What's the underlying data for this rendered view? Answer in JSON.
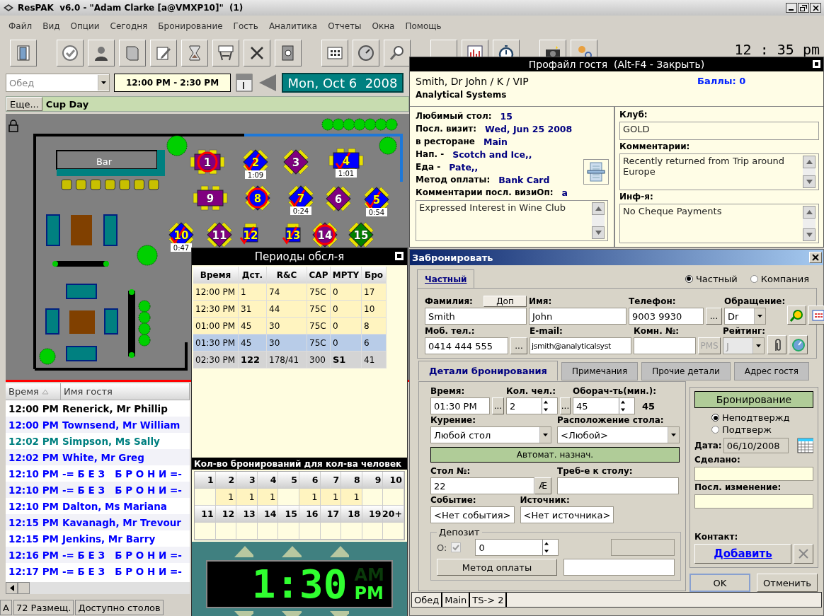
{
  "window": {
    "title": "ResPAK  v6.0 - \"Adam Clarke [a@VMXP10]\"  (1)"
  },
  "menu": [
    "Файл",
    "Вид",
    "Опции",
    "Сегодня",
    "Бронирование",
    "Гость",
    "Аналитика",
    "Отчеты",
    "Окна",
    "Помощь"
  ],
  "toolbar": {
    "clock": "12 : 35 pm"
  },
  "controls": {
    "shift": "Обед",
    "time_range": "12:00 PM - 2:30 PM",
    "date": "Mon, Oct 6  2008"
  },
  "event_bar": {
    "button": "Еще...",
    "event": "Cup Day"
  },
  "floor_plan": {
    "bar_label": "Bar",
    "tables": [
      {
        "number": "1",
        "kind": "rect",
        "color": "#800080",
        "checked": false,
        "circled": true
      },
      {
        "number": "2",
        "kind": "diamond",
        "color": "#0000ff",
        "checked": true,
        "circled": false,
        "timer": "1:09"
      },
      {
        "number": "3",
        "kind": "diamond",
        "color": "#800080",
        "checked": false,
        "circled": false
      },
      {
        "number": "4",
        "kind": "rect",
        "color": "#0000ff",
        "checked": true,
        "circled": false,
        "timer": "1:01"
      },
      {
        "number": "9",
        "kind": "rect",
        "color": "#800080",
        "checked": false,
        "circled": false
      },
      {
        "number": "8",
        "kind": "diamond",
        "color": "#0000ff",
        "checked": false,
        "circled": true
      },
      {
        "number": "7",
        "kind": "diamond",
        "color": "#0000ff",
        "checked": true,
        "circled": false,
        "timer": "0:24"
      },
      {
        "number": "6",
        "kind": "diamond",
        "color": "#800080",
        "checked": false,
        "circled": false
      },
      {
        "number": "5",
        "kind": "diamond",
        "color": "#0000ff",
        "checked": true,
        "circled": false,
        "timer": "0:54"
      },
      {
        "number": "10",
        "kind": "diamond",
        "color": "#0000ff",
        "checked": true,
        "circled": false,
        "timer": "0:47"
      },
      {
        "number": "11",
        "kind": "diamond",
        "color": "#800080",
        "checked": false,
        "circled": false
      },
      {
        "number": "12",
        "kind": "square",
        "color": "#0000ff",
        "checked": true,
        "circled": false
      },
      {
        "number": "13",
        "kind": "square",
        "color": "#0000ff",
        "checked": true,
        "circled": false
      },
      {
        "number": "14",
        "kind": "diamond",
        "color": "#800080",
        "checked": false,
        "circled": true
      },
      {
        "number": "15",
        "kind": "diamond",
        "color": "#008000",
        "checked": false,
        "circled": false
      }
    ]
  },
  "guest_list": {
    "columns": [
      {
        "label": "Время",
        "sorted": true
      },
      {
        "label": "Имя гостя",
        "sorted": false
      }
    ],
    "rows": [
      {
        "time": "12:00 PM",
        "name": "Renerick, Mr Phillip",
        "color": "#000000"
      },
      {
        "time": "12:00 PM",
        "name": "Townsend, Mr William",
        "color": "#0000ff"
      },
      {
        "time": "12:02 PM",
        "name": "Simpson, Ms Sally",
        "color": "#008080"
      },
      {
        "time": "12:02 PM",
        "name": "White, Mr Greg",
        "color": "#0000ff"
      },
      {
        "time": "12:10 PM",
        "name": "-= Б Е З   Б Р О Н И =-",
        "color": "#0000ff"
      },
      {
        "time": "12:10 PM",
        "name": "-= Б Е З   Б Р О Н И =-",
        "color": "#0000ff"
      },
      {
        "time": "12:10 PM",
        "name": "Dalton, Ms Mariana",
        "color": "#0000ff"
      },
      {
        "time": "12:15 PM",
        "name": "Kavanagh, Mr Trevour",
        "color": "#0000ff"
      },
      {
        "time": "12:15 PM",
        "name": "Jenkins, Mr Barry",
        "color": "#0000ff"
      },
      {
        "time": "12:16 PM",
        "name": "-= Б Е З   Б Р О Н И =-",
        "color": "#0000ff"
      },
      {
        "time": "12:17 PM",
        "name": "-= Б Е З   Б Р О Н И =-",
        "color": "#0000ff"
      }
    ]
  },
  "status_bar": [
    "A",
    "72 Размещ.",
    "Доступно столов"
  ],
  "service_periods": {
    "title": "Периоды обсл-я",
    "columns": [
      "Время",
      "Дст.",
      "R&C",
      "CAP",
      "MPTY",
      "Бро"
    ],
    "rows": [
      {
        "kind": "period",
        "selected": false,
        "cells": [
          "12:00 PM",
          "1",
          "74",
          "75C",
          "0",
          "17"
        ]
      },
      {
        "kind": "period",
        "selected": false,
        "cells": [
          "12:30 PM",
          "31",
          "44",
          "75C",
          "0",
          "10"
        ]
      },
      {
        "kind": "period",
        "selected": false,
        "cells": [
          "01:00 PM",
          "45",
          "30",
          "75C",
          "0",
          "8"
        ]
      },
      {
        "kind": "period",
        "selected": true,
        "cells": [
          "01:30 PM",
          "45",
          "30",
          "75C",
          "0",
          "6"
        ]
      },
      {
        "kind": "total",
        "selected": false,
        "cells": [
          "02:30 PM",
          "122",
          "178/41",
          "300",
          "S1",
          "41"
        ],
        "bold": [
          false,
          true,
          false,
          false,
          true,
          false
        ]
      }
    ]
  },
  "party_sizes": {
    "title": "Кол-во бронирований для кол-ва человек",
    "sizes": [
      {
        "size": "1"
      },
      {
        "size": "2",
        "count": "1"
      },
      {
        "size": "3",
        "count": "1"
      },
      {
        "size": "4",
        "count": "1"
      },
      {
        "size": "5"
      },
      {
        "size": "6",
        "count": "1"
      },
      {
        "size": "7",
        "count": "1"
      },
      {
        "size": "8",
        "count": "1"
      },
      {
        "size": "9"
      },
      {
        "size": "10"
      },
      {
        "size": "11"
      },
      {
        "size": "12"
      },
      {
        "size": "13"
      },
      {
        "size": "14"
      },
      {
        "size": "15"
      },
      {
        "size": "16"
      },
      {
        "size": "17"
      },
      {
        "size": "18"
      },
      {
        "size": "19"
      },
      {
        "size": "20+"
      }
    ]
  },
  "clock": {
    "time": "1:30",
    "periods": [
      {
        "label": "AM",
        "selected": false
      },
      {
        "label": "PM",
        "selected": true
      }
    ]
  },
  "guest_profile": {
    "title": "Профайл гостя  (Alt-F4 - Закрыть)",
    "name": "Smith, Dr John / K / VIP",
    "company": "Analytical Systems",
    "points": "Баллы: 0",
    "details": [
      {
        "label": "Любимый стол:",
        "value": "15"
      },
      {
        "label": "Посл. визит:",
        "value": "Wed, Jun 25 2008"
      },
      {
        "label": "в ресторане",
        "value": "Main"
      },
      {
        "label": "Нап. -",
        "value": "Scotch and Ice,,"
      },
      {
        "label": "Еда -",
        "value": "Pate,,"
      },
      {
        "label": "Метод оплаты:",
        "value": "Bank Card"
      },
      {
        "label": "Комментарии посл. визиОп:",
        "value": "a"
      }
    ],
    "last_visit_comment": "Expressed Interest in Wine Club",
    "club_label": "Клуб:",
    "club": "GOLD",
    "comments_label": "Комментарии:",
    "comments": "Recently returned from Trip around Europe",
    "info_label": "Инф-я:",
    "info": "No Cheque Payments"
  },
  "booking": {
    "title": "Забронировать",
    "guest_type": [
      {
        "label": "Частный",
        "selected": true
      },
      {
        "label": "Компания",
        "selected": false
      }
    ],
    "tab": "Частный",
    "extra_button": "Доп",
    "surname": {
      "label": "Фамилия:",
      "value": "Smith"
    },
    "first_name": {
      "label": "Имя:",
      "value": "John"
    },
    "phone": {
      "label": "Телефон:",
      "value": "9003 9930",
      "more": "..."
    },
    "salutation": {
      "label": "Обращение:",
      "value": "Dr"
    },
    "mobile": {
      "label": "Моб. тел.:",
      "value": "0414 444 555",
      "more": "..."
    },
    "email": {
      "label": "E-mail:",
      "value": "jsmith@analyticalsyst"
    },
    "room": {
      "label": "Комн. №:",
      "button": "PMS",
      "disabled": true
    },
    "rating": {
      "label": "Рейтинг:",
      "value": "J",
      "disabled": true
    },
    "tabs": [
      {
        "label": "Детали бронирования",
        "selected": true
      },
      {
        "label": "Примечания",
        "selected": false
      },
      {
        "label": "Прочие детали",
        "selected": false
      },
      {
        "label": "Адрес гостя",
        "selected": false
      }
    ],
    "time": {
      "label": "Время:",
      "value": "01:30 PM",
      "more": "..."
    },
    "party": {
      "label": "Кол. чел.:",
      "value": "2",
      "more": "..."
    },
    "turnover": {
      "label": "Оборач-ть(мин.):",
      "value": "45",
      "reading": "45"
    },
    "smoking": {
      "label": "Курение:",
      "value": "Любой стол"
    },
    "location": {
      "label": "Расположение стола:",
      "value": "<Любой>"
    },
    "auto_assign": "Автомат. назнач.",
    "table_no": {
      "label": "Стол №:",
      "value": "22",
      "button": "Æ"
    },
    "table_req": {
      "label": "Треб-е к столу:"
    },
    "event": {
      "label": "Событие:",
      "value": "<Нет события>"
    },
    "source": {
      "label": "Источник:",
      "value": "<Нет источника>"
    },
    "deposit": {
      "legend": "Депозит",
      "flag_label": "O:",
      "checked": true,
      "disabled": true,
      "amount": "0",
      "payment_button": "Метод оплаты"
    },
    "status": {
      "button": "Бронирование",
      "options": [
        {
          "label": "Неподтвержд",
          "selected": true
        },
        {
          "label": "Подтверж",
          "selected": false
        }
      ],
      "date_label": "Дата:",
      "date": "06/10/2008",
      "made_label": "Сделано:",
      "changed_label": "Посл. изменение:",
      "contact_label": "Контакт:",
      "add": "Добавить"
    },
    "ok": "OK",
    "cancel": "Отменить",
    "status_bar": [
      "Обед",
      "Main",
      "TS-> 2"
    ]
  }
}
